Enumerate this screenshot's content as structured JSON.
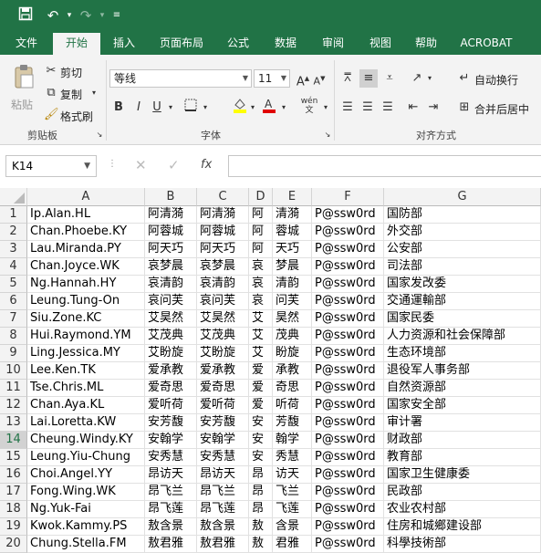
{
  "qat": {
    "save_icon": "save-icon",
    "undo_icon": "undo-icon",
    "redo_icon": "redo-icon",
    "customize_icon": "customize-icon"
  },
  "ribbon_tabs": [
    "文件",
    "开始",
    "插入",
    "页面布局",
    "公式",
    "数据",
    "审阅",
    "视图",
    "帮助",
    "ACROBAT"
  ],
  "active_tab": "开始",
  "clipboard": {
    "paste": "粘贴",
    "cut": "剪切",
    "copy": "复制",
    "format_painter": "格式刷",
    "group": "剪贴板"
  },
  "font": {
    "name": "等线",
    "size": "11",
    "bold": "B",
    "italic": "I",
    "underline": "U",
    "increase": "A",
    "decrease": "A",
    "wen": "wén",
    "group": "字体"
  },
  "alignment": {
    "wrap": "自动换行",
    "merge": "合并后居中",
    "group": "对齐方式"
  },
  "name_box": "K14",
  "fx_label": "fx",
  "columns": [
    "A",
    "B",
    "C",
    "D",
    "E",
    "F",
    "G"
  ],
  "rows": [
    {
      "n": "1",
      "a": "Ip.Alan.HL",
      "b": "阿清漪",
      "c": "阿清漪",
      "d": "阿",
      "e": "清漪",
      "f": "P@ssw0rd",
      "g": " 国防部"
    },
    {
      "n": "2",
      "a": "Chan.Phoebe.KY",
      "b": "阿蓉城",
      "c": "阿蓉城",
      "d": "阿",
      "e": "蓉城",
      "f": "P@ssw0rd",
      "g": "外交部"
    },
    {
      "n": "3",
      "a": "Lau.Miranda.PY",
      "b": "阿天巧",
      "c": "阿天巧",
      "d": "阿",
      "e": "天巧",
      "f": "P@ssw0rd",
      "g": "公安部"
    },
    {
      "n": "4",
      "a": "Chan.Joyce.WK",
      "b": "哀梦晨",
      "c": "哀梦晨",
      "d": "哀",
      "e": "梦晨",
      "f": "P@ssw0rd",
      "g": "司法部"
    },
    {
      "n": "5",
      "a": "Ng.Hannah.HY",
      "b": "哀清韵",
      "c": "哀清韵",
      "d": "哀",
      "e": "清韵",
      "f": "P@ssw0rd",
      "g": "国家发改委"
    },
    {
      "n": "6",
      "a": "Leung.Tung-On",
      "b": "哀问芙",
      "c": "哀问芙",
      "d": "哀",
      "e": "问芙",
      "f": "P@ssw0rd",
      "g": "交通運輸部"
    },
    {
      "n": "7",
      "a": "Siu.Zone.KC",
      "b": "艾昊然",
      "c": "艾昊然",
      "d": "艾",
      "e": "昊然",
      "f": "P@ssw0rd",
      "g": "国家民委"
    },
    {
      "n": "8",
      "a": "Hui.Raymond.YM",
      "b": "艾茂典",
      "c": "艾茂典",
      "d": "艾",
      "e": "茂典",
      "f": "P@ssw0rd",
      "g": "人力资源和社会保障部"
    },
    {
      "n": "9",
      "a": "Ling.Jessica.MY",
      "b": "艾盼旋",
      "c": "艾盼旋",
      "d": "艾",
      "e": "盼旋",
      "f": "P@ssw0rd",
      "g": "生态环境部"
    },
    {
      "n": "10",
      "a": "Lee.Ken.TK",
      "b": "爱承教",
      "c": "爱承教",
      "d": "爱",
      "e": "承教",
      "f": "P@ssw0rd",
      "g": "退役军人事务部"
    },
    {
      "n": "11",
      "a": "Tse.Chris.ML",
      "b": "爱奇思",
      "c": "爱奇思",
      "d": "爱",
      "e": "奇思",
      "f": "P@ssw0rd",
      "g": "自然资源部"
    },
    {
      "n": "12",
      "a": "Chan.Aya.KL",
      "b": "爱听荷",
      "c": "爱听荷",
      "d": "爱",
      "e": "听荷",
      "f": "P@ssw0rd",
      "g": "国家安全部"
    },
    {
      "n": "13",
      "a": "Lai.Loretta.KW",
      "b": "安芳馥",
      "c": "安芳馥",
      "d": "安",
      "e": "芳馥",
      "f": "P@ssw0rd",
      "g": "审计署"
    },
    {
      "n": "14",
      "a": "Cheung.Windy.KY",
      "b": "安翰学",
      "c": "安翰学",
      "d": "安",
      "e": "翰学",
      "f": "P@ssw0rd",
      "g": "财政部"
    },
    {
      "n": "15",
      "a": "Leung.Yiu-Chung",
      "b": "安秀慧",
      "c": "安秀慧",
      "d": "安",
      "e": "秀慧",
      "f": "P@ssw0rd",
      "g": "教育部"
    },
    {
      "n": "16",
      "a": "Choi.Angel.YY",
      "b": "昂访天",
      "c": "昂访天",
      "d": "昂",
      "e": "访天",
      "f": "P@ssw0rd",
      "g": "国家卫生健康委"
    },
    {
      "n": "17",
      "a": "Fong.Wing.WK",
      "b": "昂飞兰",
      "c": "昂飞兰",
      "d": "昂",
      "e": "飞兰",
      "f": "P@ssw0rd",
      "g": "民政部"
    },
    {
      "n": "18",
      "a": "Ng.Yuk-Fai",
      "b": "昂飞莲",
      "c": "昂飞莲",
      "d": "昂",
      "e": "飞莲",
      "f": "P@ssw0rd",
      "g": "农业农村部"
    },
    {
      "n": "19",
      "a": "Kwok.Kammy.PS",
      "b": "敖含景",
      "c": "敖含景",
      "d": "敖",
      "e": "含景",
      "f": "P@ssw0rd",
      "g": "住房和城鄉建设部"
    },
    {
      "n": "20",
      "a": "Chung.Stella.FM",
      "b": "敖君雅",
      "c": "敖君雅",
      "d": "敖",
      "e": "君雅",
      "f": "P@ssw0rd",
      "g": "科學技術部"
    }
  ]
}
